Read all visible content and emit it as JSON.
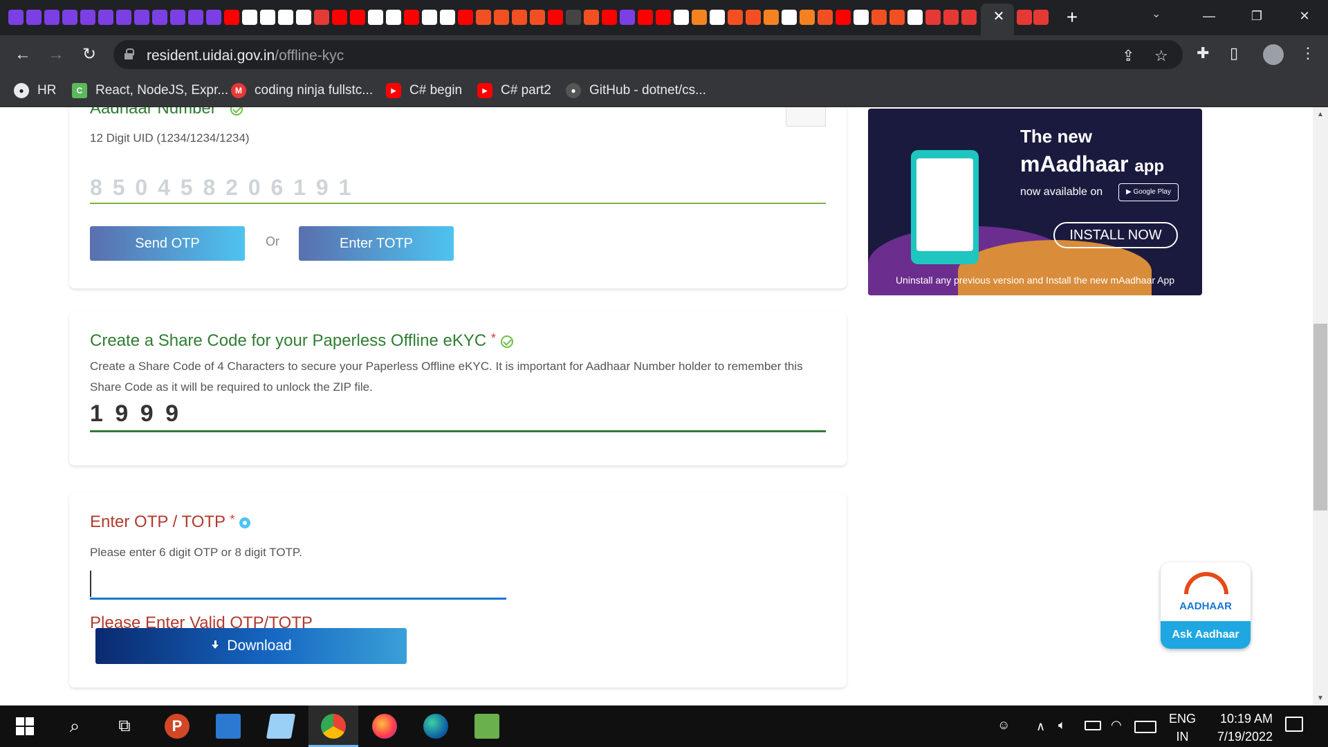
{
  "browser": {
    "url_host": "resident.uidai.gov.in",
    "url_path": "/offline-kyc",
    "bookmarks": [
      {
        "label": "HR",
        "icon": "github-icon",
        "color": "#e8eaed"
      },
      {
        "label": "React, NodeJS, Expr...",
        "icon": "codementor-icon",
        "color": "#5cb85c"
      },
      {
        "label": "coding ninja fullstc...",
        "icon": "gmail-icon",
        "color": "#e53935"
      },
      {
        "label": "C# begin",
        "icon": "youtube-icon",
        "color": "#ff0000"
      },
      {
        "label": "C# part2",
        "icon": "youtube-icon",
        "color": "#ff0000"
      },
      {
        "label": "GitHub - dotnet/cs...",
        "icon": "github-icon",
        "color": "#555555"
      }
    ]
  },
  "form": {
    "aadhaar": {
      "label": "Aadhaar Number",
      "required_mark": "*",
      "hint": "12 Digit UID (1234/1234/1234)",
      "value": "8 5 0 4 5 8 2 0 6 1 9 1"
    },
    "send_otp_label": "Send OTP",
    "or_label": "Or",
    "enter_totp_label": "Enter TOTP",
    "share_code": {
      "label": "Create a Share Code for your Paperless Offline eKYC",
      "required_mark": "*",
      "hint": "Create a Share Code of 4 Characters to secure your Paperless Offline eKYC. It is important for Aadhaar Number holder to remember this Share Code as it will be required to unlock the ZIP file.",
      "value": "1 9 9 9"
    },
    "otp": {
      "label": "Enter OTP / TOTP",
      "required_mark": "*",
      "hint": "Please enter 6 digit OTP or 8 digit TOTP.",
      "value": "",
      "error": "Please Enter Valid OTP/TOTP"
    },
    "download_label": "Download"
  },
  "ad": {
    "line1": "The new",
    "line2": "mAadhaar",
    "line2_suffix": "app",
    "line3": "now available on",
    "store_badge": "Google Play",
    "install_label": "INSTALL NOW",
    "footer": "Uninstall any previous version and Install the new mAadhaar App"
  },
  "ask_aadhaar": {
    "brand": "AADHAAR",
    "label": "Ask Aadhaar"
  },
  "taskbar": {
    "lang_top": "ENG",
    "lang_bottom": "IN",
    "time": "10:19 AM",
    "date": "7/19/2022"
  },
  "colors": {
    "accent_green": "#2e7d32",
    "error_red": "#b03a2e",
    "download_blue": "#0a2a6e"
  }
}
